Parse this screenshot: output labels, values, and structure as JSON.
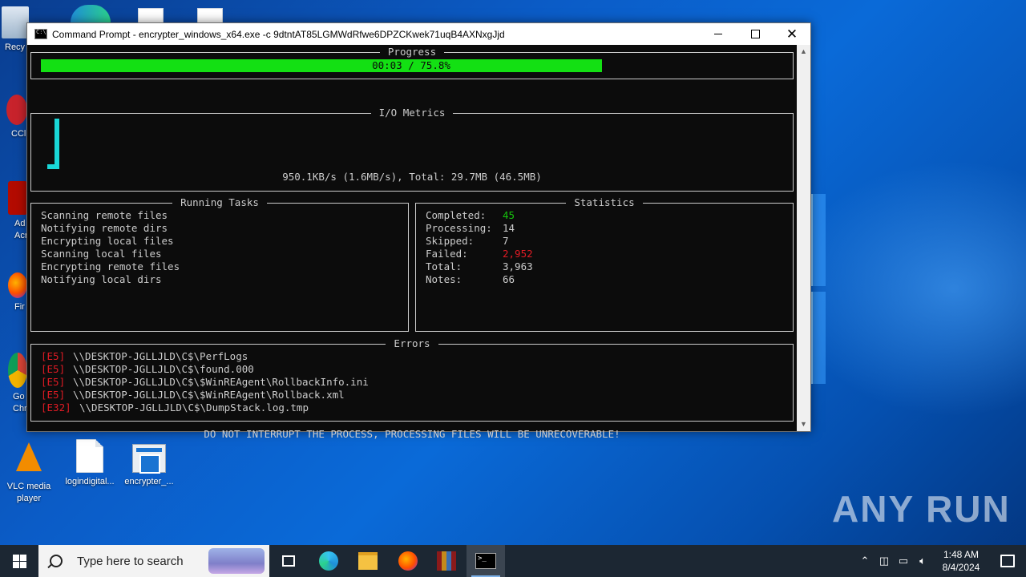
{
  "desktop": {
    "icons": [
      {
        "label": "Recy",
        "icon": "recycle-bin-icon"
      },
      {
        "label": "CCl",
        "icon": "ccleaner-icon"
      },
      {
        "label": "Ad\nAcr",
        "icon": "acrobat-icon"
      },
      {
        "label": "Fir",
        "icon": "firefox-icon"
      },
      {
        "label": "Go\nChr",
        "icon": "chrome-icon"
      },
      {
        "label": "VLC media player",
        "icon": "vlc-icon"
      },
      {
        "label": "logindigital...",
        "icon": "document-icon"
      },
      {
        "label": "encrypter_...",
        "icon": "executable-icon"
      }
    ],
    "watermark": "ANY RUN"
  },
  "window": {
    "title": "Command Prompt - encrypter_windows_x64.exe  -c 9dtntAT85LGMWdRfwe6DPZCKwek71uqB4AXNxgJjd",
    "minimize_glyph": "—",
    "maximize_glyph": "☐",
    "close_glyph": "✕"
  },
  "progress": {
    "title": "Progress",
    "text": "00:03 / 75.8%",
    "fraction": 0.758
  },
  "io_metrics": {
    "title": "I/O Metrics",
    "text": "950.1KB/s (1.6MB/s), Total: 29.7MB (46.5MB)"
  },
  "running_tasks": {
    "title": "Running Tasks",
    "items": [
      "Scanning remote files",
      "Notifying remote dirs",
      "Encrypting local files",
      "Scanning local files",
      "Encrypting remote files",
      "Notifying local dirs"
    ]
  },
  "statistics": {
    "title": "Statistics",
    "rows": [
      {
        "label": "Completed:",
        "value": "45",
        "color": "#16c60c"
      },
      {
        "label": "Processing:",
        "value": "14",
        "color": "#cccccc"
      },
      {
        "label": "Skipped:",
        "value": "7",
        "color": "#cccccc"
      },
      {
        "label": "Failed:",
        "value": "2,952",
        "color": "#e01b24"
      },
      {
        "label": "Total:",
        "value": "3,963",
        "color": "#cccccc"
      },
      {
        "label": "Notes:",
        "value": "66",
        "color": "#cccccc"
      }
    ]
  },
  "errors": {
    "title": "Errors",
    "items": [
      {
        "code": "[E5]",
        "path": "\\\\DESKTOP-JGLLJLD\\C$\\PerfLogs"
      },
      {
        "code": "[E5]",
        "path": "\\\\DESKTOP-JGLLJLD\\C$\\found.000"
      },
      {
        "code": "[E5]",
        "path": "\\\\DESKTOP-JGLLJLD\\C$\\$WinREAgent\\RollbackInfo.ini"
      },
      {
        "code": "[E5]",
        "path": "\\\\DESKTOP-JGLLJLD\\C$\\$WinREAgent\\Rollback.xml"
      },
      {
        "code": "[E32]",
        "path": "\\\\DESKTOP-JGLLJLD\\C$\\DumpStack.log.tmp"
      }
    ]
  },
  "warning": "DO NOT INTERRUPT THE PROCESS, PROCESSING FILES WILL BE UNRECOVERABLE!",
  "taskbar": {
    "search_placeholder": "Type here to search",
    "time": "1:48 AM",
    "date": "8/4/2024"
  }
}
